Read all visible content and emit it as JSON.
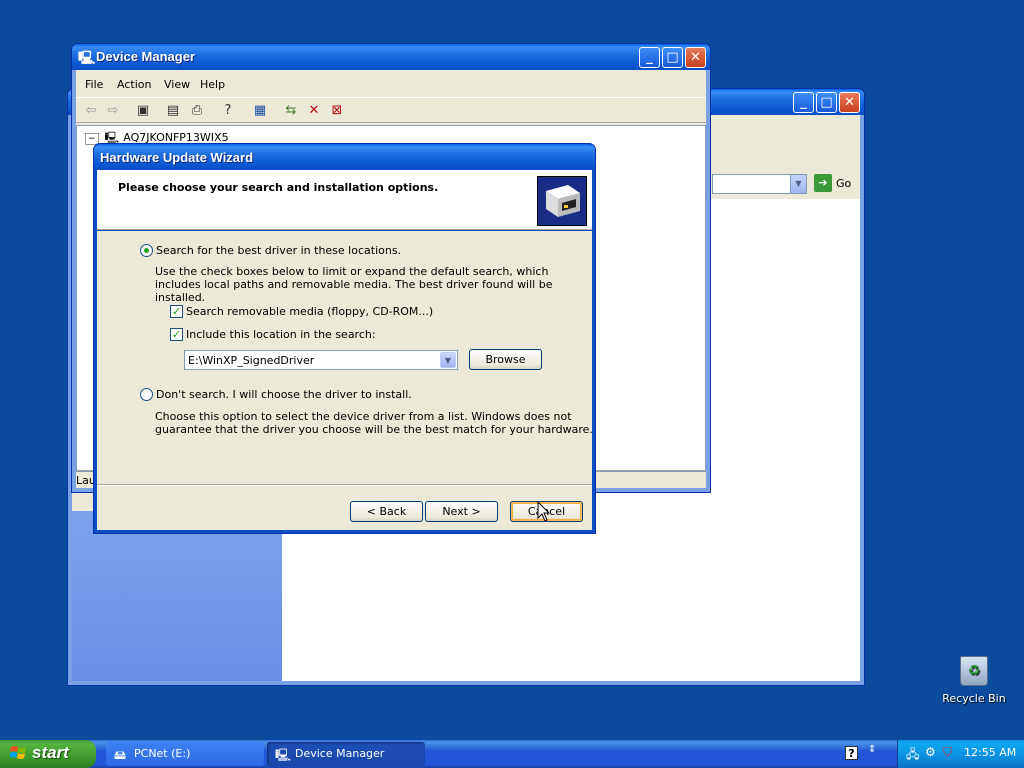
{
  "bg_window": {
    "go_label": "Go"
  },
  "device_manager": {
    "title": "Device Manager",
    "menu": [
      "File",
      "Action",
      "View",
      "Help"
    ],
    "tree_root": "AQ7JKONFP13WIX5",
    "status_partial": "Lau"
  },
  "wizard": {
    "title": "Hardware Update Wizard",
    "heading": "Please choose your search and installation options.",
    "option1_label": "Search for the best driver in these locations.",
    "option1_desc": "Use the check boxes below to limit or expand the default search, which includes local paths and removable media. The best driver found will be installed.",
    "chk_removable_label": "Search removable media (floppy, CD-ROM...)",
    "chk_location_label": "Include this location in the search:",
    "location_value": "E:\\WinXP_SignedDriver",
    "browse_label": "Browse",
    "option2_label": "Don't search. I will choose the driver to install.",
    "option2_desc": "Choose this option to select the device driver from a list.  Windows does not guarantee that the driver you choose will be the best match for your hardware.",
    "back_label": "< Back",
    "next_label": "Next >",
    "cancel_label": "Cancel",
    "option1_selected": true,
    "chk_removable_checked": true,
    "chk_location_checked": true
  },
  "desktop": {
    "recycle_bin_label": "Recycle Bin"
  },
  "taskbar": {
    "start_label": "start",
    "tasks": [
      {
        "label": "PCNet (E:)",
        "icon": "drive-icon"
      },
      {
        "label": "Device Manager",
        "icon": "device-manager-icon"
      }
    ],
    "clock": "12:55 AM"
  }
}
